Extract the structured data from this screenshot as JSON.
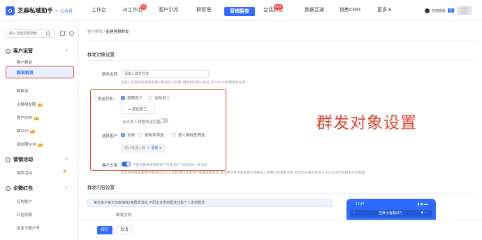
{
  "topbar": {
    "app_name": "芝麻私域助手",
    "account": "公众号",
    "nav": [
      {
        "label": "工作台"
      },
      {
        "label": "AI工作流",
        "badge": "AI"
      },
      {
        "label": "客户引流"
      },
      {
        "label": "群管理"
      },
      {
        "label": "营销裂变"
      },
      {
        "label": "会话质检",
        "badge": "HOT"
      },
      {
        "label": "数据互通"
      },
      {
        "label": "销售CRM"
      },
      {
        "label": "更多"
      }
    ],
    "active_nav": "营销裂变",
    "user": {
      "name": "芝麻客服",
      "tag": "企"
    }
  },
  "sidebar": {
    "search_placeholder": "输入功能名称搜索",
    "groups": [
      {
        "label": "客户运营",
        "items": [
          "客户群发",
          "群发群发",
          "群群发",
          "企微朋友圈",
          "客户SOP",
          "群SOP",
          "朋友圈SOP"
        ]
      },
      {
        "label": "营销活动",
        "items": [
          "抽奖活动"
        ]
      },
      {
        "label": "企微红包",
        "items": [
          "红包账户",
          "红包列表",
          "自定义账户号"
        ]
      }
    ],
    "active_item": "群群发"
  },
  "breadcrumb": {
    "parent": "客户群发",
    "separator": "/",
    "current": "新建客群群发"
  },
  "form": {
    "section1_title": "群发对象设置",
    "task_name_label": "群发名称:",
    "task_name_placeholder": "请输入群发名称",
    "task_name_hint": "未输入名称时系统将采用以发送员工名称+群发时间默认命名 (24-02-20客群群发任务)",
    "target_label": "发送对象:",
    "target_options": [
      "按照员工",
      "全部员工"
    ],
    "add_staff_button": "+ 添加员工",
    "exclude_toggle_label": "允许员工调整发送范围",
    "filter_label": "选择客户:",
    "filter_options": [
      "全部",
      "按条件筛选",
      "按人群标签筛选"
    ],
    "estimate_text": "预计发送人数: 0",
    "refresh_label": "更新",
    "dedupe_label": "客户去重:",
    "dedupe_hint": "开启后群发将按照客户去重,客户只会收到一次消息",
    "dedupe_note": "如您会将群发策略为每周/N次以上,同时建议您将客户去重设置开启,该设置可有效避免客户因被员工频繁打扰导致流失,且实际效果会受客户在企业中不同群发状态数据",
    "section2_title": "群发内容设置",
    "notice": "每位客户每天仅能接收1条群发消息,不同企业发的群发还是个人发的群发",
    "partial_label": "群发方式:"
  },
  "annotation": "群发对象设置",
  "phone_preview": {
    "time": "17:47",
    "title": "芝麻小客服(47)"
  },
  "footer": {
    "save": "保存",
    "cancel": "取消"
  }
}
